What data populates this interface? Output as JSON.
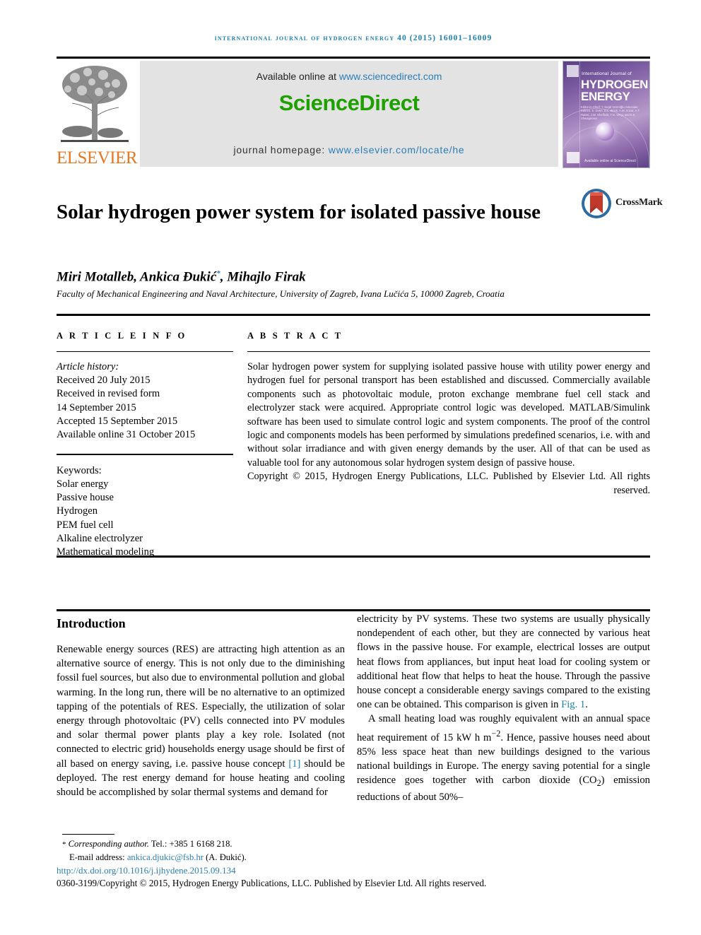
{
  "running_head": "international journal of hydrogen energy 40 (2015) 16001–16009",
  "masthead": {
    "available_prefix": "Available online at ",
    "available_link": "www.sciencedirect.com",
    "sciencedirect_logo": "ScienceDirect",
    "homepage_prefix": "journal homepage: ",
    "homepage_link": "www.elsevier.com/locate/he",
    "elsevier_wordmark": "ELSEVIER",
    "cover": {
      "small_line": "International Journal of",
      "head_line1": "HYDROGEN",
      "head_line2": "ENERGY",
      "editors": "Editor-in-Chief: T. Nejat Veziroğlu    Associate Editors: S. Dunn, D.L. Block, A.M. Anzar, A.T. Raissi, J.W. Sheffield, T.N. Verçç and E.E. Shwageraus",
      "science_direct_foot": "Available online at ScienceDirect"
    }
  },
  "article": {
    "title": "Solar hydrogen power system for isolated passive house",
    "crossmark_label": "CrossMark",
    "authors_part1": "Miri Motalleb, Ankica Đukić",
    "authors_star": "*",
    "authors_part2": ", Mihajlo Firak",
    "affiliation": "Faculty of Mechanical Engineering and Naval Architecture, University of Zagreb, Ivana Lučića 5, 10000 Zagreb, Croatia"
  },
  "article_info": {
    "heading": "A R T I C L E   I N F O",
    "history_label": "Article history:",
    "history": [
      "Received 20 July 2015",
      "Received in revised form",
      "14 September 2015",
      "Accepted 15 September 2015",
      "Available online 31 October 2015"
    ],
    "keywords_label": "Keywords:",
    "keywords": [
      "Solar energy",
      "Passive house",
      "Hydrogen",
      "PEM fuel cell",
      "Alkaline electrolyzer",
      "Mathematical modeling"
    ]
  },
  "abstract": {
    "heading": "A B S T R A C T",
    "body": "Solar hydrogen power system for supplying isolated passive house with utility power energy and hydrogen fuel for personal transport has been established and discussed. Commercially available components such as photovoltaic module, proton exchange membrane fuel cell stack and electrolyzer stack were acquired. Appropriate control logic was developed. MATLAB/Simulink software has been used to simulate control logic and system components. The proof of the control logic and components models has been performed by simulations predefined scenarios, i.e. with and without solar irradiance and with given energy demands by the user. All of that can be used as valuable tool for any autonomous solar hydrogen system design of passive house.",
    "copyright": "Copyright © 2015, Hydrogen Energy Publications, LLC. Published by Elsevier Ltd. All rights reserved."
  },
  "introduction": {
    "heading": "Introduction",
    "left_paragraph": "Renewable energy sources (RES) are attracting high attention as an alternative source of energy. This is not only due to the diminishing fossil fuel sources, but also due to environmental pollution and global warming. In the long run, there will be no alternative to an optimized tapping of the potentials of RES. Especially, the utilization of solar energy through photovoltaic (PV) cells connected into PV modules and solar thermal power plants play a key role. Isolated (not connected to electric grid) households energy usage should be first of all based on energy saving, i.e. passive house concept ",
    "left_ref": "[1]",
    "left_paragraph_cont": " should be deployed. The rest energy demand for house heating and cooling should be accomplished by solar thermal systems and demand for",
    "right_paragraph_a": "electricity by PV systems. These two systems are usually physically nondependent of each other, but they are connected by various heat flows in the passive house. For example, electrical losses are output heat flows from appliances, but input heat load for cooling system or additional heat flow that helps to heat the house. Through the passive house concept a considerable energy savings compared to the existing one can be obtained. This comparison is given in ",
    "right_ref": "Fig. 1",
    "right_paragraph_a_end": ".",
    "right_paragraph_b_pre": "A small heating load was roughly equivalent with an annual space heat requirement of 15 kW h m",
    "right_sup": "−2",
    "right_paragraph_b_post": ". Hence, passive houses need about 85% less space heat than new buildings designed to the various national buildings in Europe. The energy saving potential for a single residence goes together with carbon dioxide (CO",
    "right_sub": "2",
    "right_paragraph_b_tail": ") emission reductions of about 50%–"
  },
  "footer": {
    "corresponding_star": "*",
    "corresponding_label": "Corresponding author.",
    "tel": " Tel.: +385 1 6168 218.",
    "email_label": "E-mail address: ",
    "email": "ankica.djukic@fsb.hr",
    "email_owner": " (A. Đukić).",
    "doi": "http://dx.doi.org/10.1016/j.ijhydene.2015.09.134",
    "issn_line": "0360-3199/Copyright © 2015, Hydrogen Energy Publications, LLC. Published by Elsevier Ltd. All rights reserved."
  },
  "colors": {
    "link_blue": "#2a7eb8",
    "running_head_blue": "#1a7fb5",
    "sciencedirect_green": "#1ea000",
    "elsevier_orange": "#E87722",
    "crossmark_red": "#c0392b",
    "crossmark_blue": "#2d6ca2"
  }
}
